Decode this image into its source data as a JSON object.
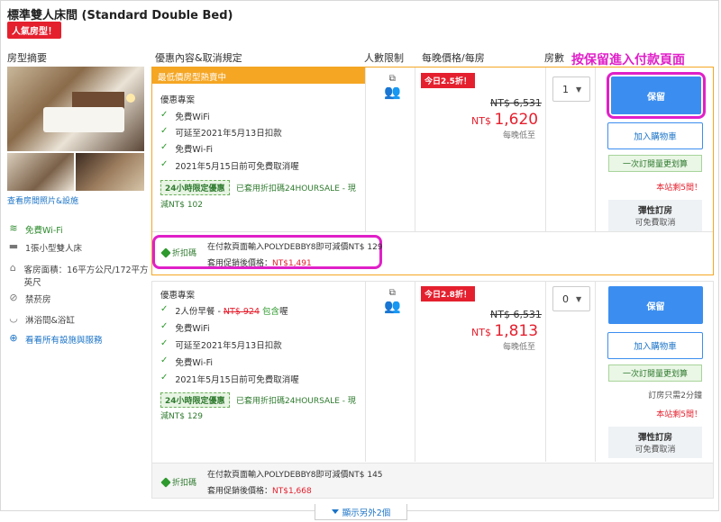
{
  "room": {
    "title": "標準雙人床間 (Standard Double Bed)",
    "badge": "人氣房型！"
  },
  "columns": {
    "summary": "房型摘要",
    "offer": "優惠內容&取消規定",
    "persons": "人數限制",
    "price": "每晚價格/每房",
    "rooms": "房數"
  },
  "annotation": {
    "text": "按保留進入付款頁面"
  },
  "summary": {
    "photos_link": "查看房間照片&設施",
    "amenities": [
      {
        "icon": "wifi-icon",
        "label": "免費Wi-Fi"
      },
      {
        "icon": "bed-icon",
        "label": "1張小型雙人床"
      },
      {
        "icon": "house-icon",
        "label": "客房面積：16平方公尺/172平方英尺"
      },
      {
        "icon": "no-smoking-icon",
        "label": "禁菸房"
      },
      {
        "icon": "bath-icon",
        "label": "淋浴間&浴缸"
      },
      {
        "icon": "plus-circle-icon",
        "label": "看看所有設施與服務"
      }
    ]
  },
  "offers": [
    {
      "banner": "最低價房型熱賣中",
      "plan": "優惠專案",
      "features": [
        "免費WiFi",
        "可延至2021年5月13日扣款",
        "免費Wi-Fi",
        "2021年5月15日前可免費取消喔"
      ],
      "tag_24h": "24小時限定優惠",
      "applied_line1": "已套用折扣碼24HOURSALE - 現",
      "applied_line2": "減NT$ 102",
      "discount_badge": "今日2.5折！",
      "original_price": "NT$ 6,531",
      "price_currency": "NT$",
      "price_value": "1,620",
      "per_night": "每晚低至",
      "qty": "1",
      "reserve": "保留",
      "cart": "加入購物車",
      "once_tag": "一次訂閱量更划算",
      "last_rooms": "本站剩5間！",
      "flex_title": "彈性訂房",
      "flex_sub": "可免費取消",
      "promo_tag": "折扣碼",
      "promo_line1": "在付款頁面輸入POLYDEBBY8即可減價NT$ 129",
      "promo_line2_label": "套用促銷後價格：",
      "promo_line2_value": "NT$1,491"
    },
    {
      "plan": "優惠專案",
      "breakfast_prefix": "2人份早餐 - ",
      "breakfast_strike": "NT$ 924",
      "breakfast_included": "包含",
      "breakfast_suffix": "喔",
      "features": [
        "免費WiFi",
        "可延至2021年5月13日扣款",
        "免費Wi-Fi",
        "2021年5月15日前可免費取消喔"
      ],
      "tag_24h": "24小時限定優惠",
      "applied_line1": "已套用折扣碼24HOURSALE - 現",
      "applied_line2": "減NT$ 129",
      "discount_badge": "今日2.8折！",
      "original_price": "NT$ 6,531",
      "price_currency": "NT$",
      "price_value": "1,813",
      "per_night": "每晚低至",
      "qty": "0",
      "reserve": "保留",
      "cart": "加入購物車",
      "once_tag": "一次訂閱量更划算",
      "note": "訂房只需2分鐘",
      "last_rooms": "本站剩5間！",
      "flex_title": "彈性訂房",
      "flex_sub": "可免費取消",
      "promo_tag": "折扣碼",
      "promo_line1": "在付款頁面輸入POLYDEBBY8即可減價NT$ 145",
      "promo_line2_label": "套用促銷後價格：",
      "promo_line2_value": "NT$1,668"
    }
  ],
  "show_more": "顯示另外2個",
  "colors": {
    "accent_blue": "#3b8ef0",
    "sale_red": "#e5202e",
    "banner_orange": "#f5a623",
    "annotation_magenta": "#e020c8",
    "check_green": "#2e9a2e"
  }
}
